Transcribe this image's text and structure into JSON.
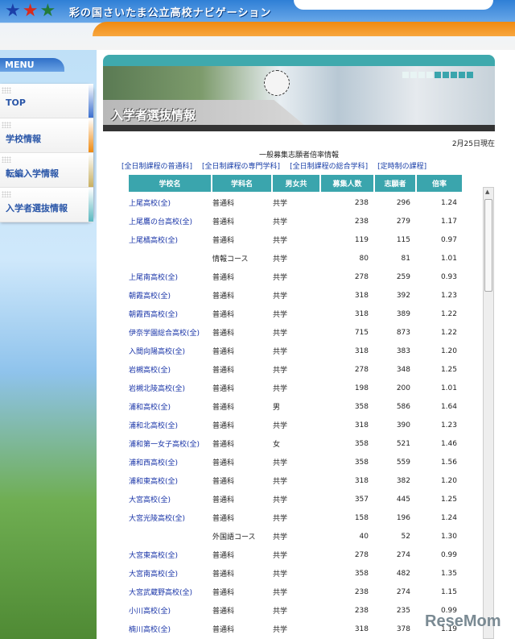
{
  "header": {
    "site_title": "彩の国さいたま公立高校ナビゲーション"
  },
  "sidebar": {
    "menu_label": "MENU",
    "items": [
      {
        "label": "TOP",
        "color": "#3a6fd0"
      },
      {
        "label": "学校情報",
        "color": "#f08a10"
      },
      {
        "label": "転編入学情報",
        "color": "#c9b060"
      },
      {
        "label": "入学者選抜情報",
        "color": "#5ab8c0"
      }
    ]
  },
  "banner": {
    "title": "入学者選抜情報"
  },
  "content": {
    "date": "2月25日現在",
    "subtitle": "一般募集志願者倍率情報",
    "links": [
      "[全日制課程の普通科]",
      "[全日制課程の専門学科]",
      "[全日制課程の総合学科]",
      "[定時制の課程]"
    ],
    "columns": [
      "学校名",
      "学科名",
      "男女共",
      "募集人数",
      "志願者",
      "倍率"
    ],
    "rows": [
      [
        "上尾高校(全)",
        "普通科",
        "共学",
        "238",
        "296",
        "1.24"
      ],
      [
        "上尾鷹の台高校(全)",
        "普通科",
        "共学",
        "238",
        "279",
        "1.17"
      ],
      [
        "上尾橘高校(全)",
        "普通科",
        "共学",
        "119",
        "115",
        "0.97"
      ],
      [
        "",
        "情報コース",
        "共学",
        "80",
        "81",
        "1.01"
      ],
      [
        "上尾南高校(全)",
        "普通科",
        "共学",
        "278",
        "259",
        "0.93"
      ],
      [
        "朝霞高校(全)",
        "普通科",
        "共学",
        "318",
        "392",
        "1.23"
      ],
      [
        "朝霞西高校(全)",
        "普通科",
        "共学",
        "318",
        "389",
        "1.22"
      ],
      [
        "伊奈学園総合高校(全)",
        "普通科",
        "共学",
        "715",
        "873",
        "1.22"
      ],
      [
        "入間向陽高校(全)",
        "普通科",
        "共学",
        "318",
        "383",
        "1.20"
      ],
      [
        "岩槻高校(全)",
        "普通科",
        "共学",
        "278",
        "348",
        "1.25"
      ],
      [
        "岩槻北陵高校(全)",
        "普通科",
        "共学",
        "198",
        "200",
        "1.01"
      ],
      [
        "浦和高校(全)",
        "普通科",
        "男",
        "358",
        "586",
        "1.64"
      ],
      [
        "浦和北高校(全)",
        "普通科",
        "共学",
        "318",
        "390",
        "1.23"
      ],
      [
        "浦和第一女子高校(全)",
        "普通科",
        "女",
        "358",
        "521",
        "1.46"
      ],
      [
        "浦和西高校(全)",
        "普通科",
        "共学",
        "358",
        "559",
        "1.56"
      ],
      [
        "浦和東高校(全)",
        "普通科",
        "共学",
        "318",
        "382",
        "1.20"
      ],
      [
        "大宮高校(全)",
        "普通科",
        "共学",
        "357",
        "445",
        "1.25"
      ],
      [
        "大宮光陵高校(全)",
        "普通科",
        "共学",
        "158",
        "196",
        "1.24"
      ],
      [
        "",
        "外国語コース",
        "共学",
        "40",
        "52",
        "1.30"
      ],
      [
        "大宮東高校(全)",
        "普通科",
        "共学",
        "278",
        "274",
        "0.99"
      ],
      [
        "大宮南高校(全)",
        "普通科",
        "共学",
        "358",
        "482",
        "1.35"
      ],
      [
        "大宮武蔵野高校(全)",
        "普通科",
        "共学",
        "238",
        "274",
        "1.15"
      ],
      [
        "小川高校(全)",
        "普通科",
        "共学",
        "238",
        "235",
        "0.99"
      ],
      [
        "楠川高校(全)",
        "普通科",
        "共学",
        "318",
        "378",
        "1.19"
      ]
    ]
  },
  "watermark": "ReseMom"
}
